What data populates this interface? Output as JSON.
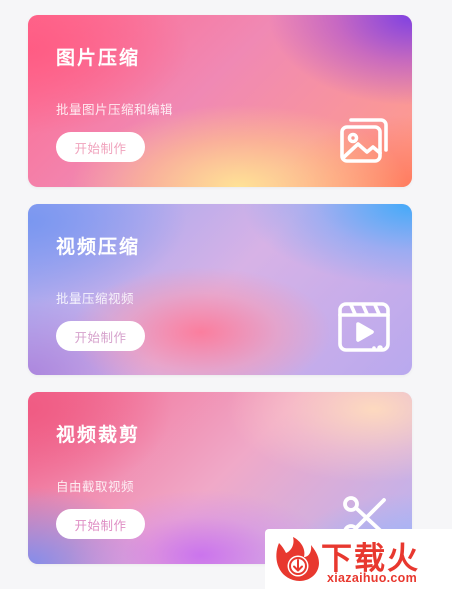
{
  "cards": [
    {
      "title": "图片压缩",
      "subtitle": "批量图片压缩和编辑",
      "button": "开始制作",
      "icon": "image-compress-icon"
    },
    {
      "title": "视频压缩",
      "subtitle": "批量压缩视频",
      "button": "开始制作",
      "icon": "video-play-icon"
    },
    {
      "title": "视频裁剪",
      "subtitle": "自由截取视频",
      "button": "开始制作",
      "icon": "scissors-icon"
    }
  ],
  "watermark": {
    "brand": "下载火",
    "url": "xiazaihuo.com",
    "color": "#e8382f"
  }
}
